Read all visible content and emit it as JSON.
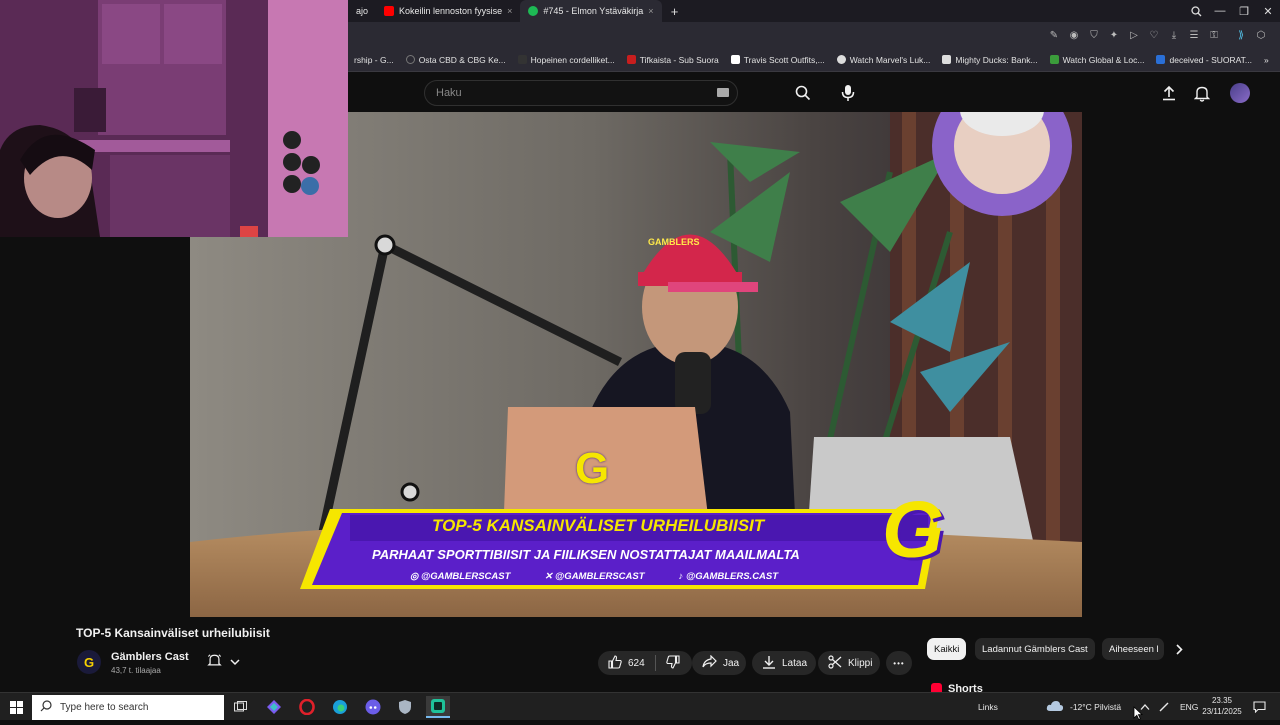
{
  "browser": {
    "tabs": [
      {
        "label": "ajo",
        "color": "#2b2a33",
        "active": false
      },
      {
        "label": "Kokeilin lennoston fyysise",
        "color": "#ff0000",
        "active": false
      },
      {
        "label": "#745 - Elmon Ystäväkirja",
        "color": "#1db954",
        "active": true
      }
    ],
    "new_tab": "+",
    "bookmarks": [
      {
        "label": "rship - G...",
        "color": "#555555"
      },
      {
        "label": "Osta CBD & CBG Ke...",
        "color": "#777777"
      },
      {
        "label": "Hopeinen cordelliket...",
        "color": "#333333"
      },
      {
        "label": "Tifkaista - Sub Suora",
        "color": "#c81e1e"
      },
      {
        "label": "Travis Scott Outfits,...",
        "color": "#ffffff"
      },
      {
        "label": "Watch Marvel's Luk...",
        "color": "#dddddd"
      },
      {
        "label": "Mighty Ducks: Bank...",
        "color": "#dddddd"
      },
      {
        "label": "Watch Global & Loc...",
        "color": "#3b9c3b"
      },
      {
        "label": "deceived - SUORAT...",
        "color": "#2a6fd6"
      }
    ]
  },
  "youtube": {
    "search_placeholder": "Haku",
    "video": {
      "banner_title": "TOP-5 KANSAINVÄLISET URHEILUBIISIT",
      "banner_subtitle": "PARHAAT SPORTTIBIISIT JA FIILIKSEN NOSTATTAJAT MAAILMALTA",
      "handles": [
        "@GAMBLERSCAST",
        "@GAMBLERSCAST",
        "@GAMBLERS.CAST"
      ],
      "logo_letter": "G",
      "cap_text": "GAMBLERS"
    },
    "title": "TOP-5 Kansainväliset urheilubiisit",
    "channel": {
      "name": "Gämblers Cast",
      "subscribers": "43,7 t. tilaajaa",
      "avatar_letter": "G"
    },
    "actions": {
      "likes": "624",
      "share": "Jaa",
      "download": "Lataa",
      "clip": "Klippi",
      "more": "•••"
    },
    "chips": [
      "Kaikki",
      "Ladannut Gämblers Cast",
      "Aiheeseen l"
    ],
    "shorts_label": "Shorts"
  },
  "taskbar": {
    "search_placeholder": "Type here to search",
    "links_label": "Links",
    "weather": "-12°C  Pilvistä",
    "language": "ENG",
    "time": "23.35",
    "date": "23/11/2025"
  },
  "colors": {
    "youtube_bg": "#0f0f0f",
    "banner_purple": "#5b1fc9",
    "banner_yellow": "#f6e600",
    "taskbar_bg": "#202020"
  }
}
